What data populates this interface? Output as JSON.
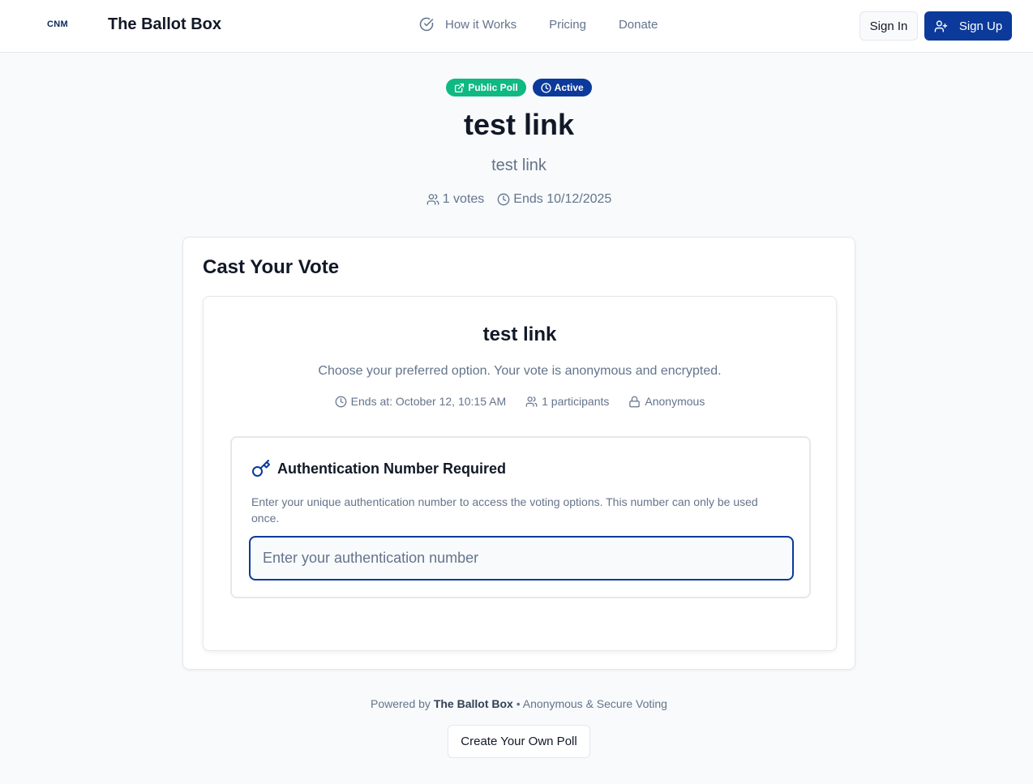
{
  "header": {
    "logo_text": "CNM",
    "brand": "The Ballot Box",
    "nav": {
      "how_it_works": "How it Works",
      "pricing": "Pricing",
      "donate": "Donate"
    },
    "sign_in": "Sign In",
    "sign_up": "Sign Up"
  },
  "poll": {
    "badges": {
      "public": "Public Poll",
      "active": "Active"
    },
    "title": "test link",
    "subtitle": "test link",
    "votes": "1 votes",
    "ends": "Ends 10/12/2025"
  },
  "card": {
    "title": "Cast Your Vote",
    "inner_title": "test link",
    "description": "Choose your preferred option. Your vote is anonymous and encrypted.",
    "ends_at": "Ends at: October 12, 10:15 AM",
    "participants": "1 participants",
    "anonymous": "Anonymous",
    "auth": {
      "title": "Authentication Number Required",
      "description": "Enter your unique authentication number to access the voting options. This number can only be used once.",
      "placeholder": "Enter your authentication number",
      "value": ""
    }
  },
  "footer": {
    "powered_by": "Powered by",
    "brand": "The Ballot Box",
    "tagline": "• Anonymous & Secure Voting",
    "create_button": "Create Your Own Poll"
  },
  "colors": {
    "primary": "#0b3a9a",
    "success": "#10b981",
    "muted": "#64748b",
    "background": "#f8fafc"
  }
}
